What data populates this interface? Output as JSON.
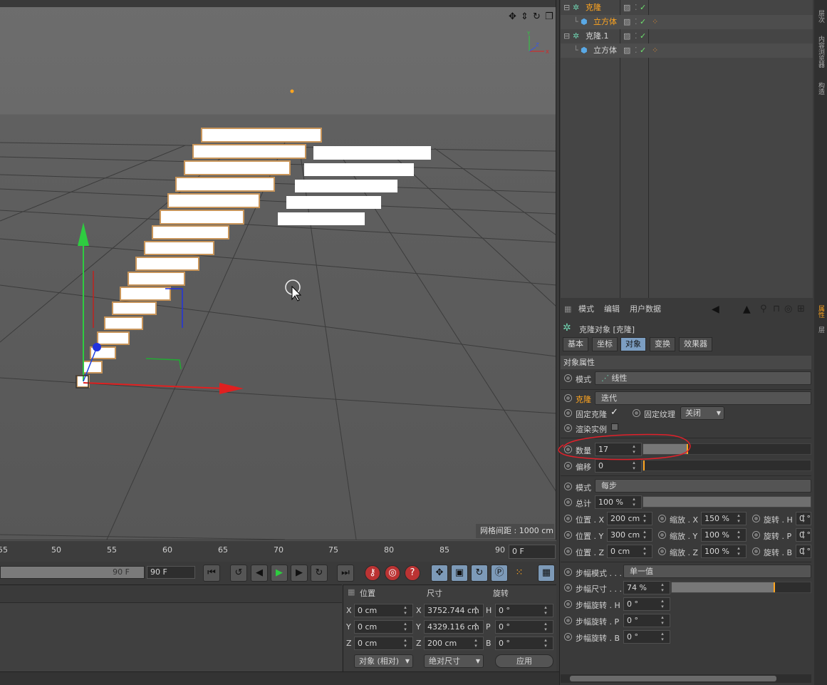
{
  "viewport": {
    "grid_readout": "网格间距 : 1000 cm"
  },
  "timeline": {
    "ticks": [
      "55",
      "50",
      "55",
      "60",
      "65",
      "70",
      "75",
      "80",
      "85",
      "90"
    ],
    "current_frame": "0 F",
    "range_end_label": "90 F",
    "end_frame": "90 F"
  },
  "coords": {
    "headers": {
      "position": "位置",
      "size": "尺寸",
      "rotation": "旋转"
    },
    "rows": [
      {
        "axis": "X",
        "pos": "0 cm",
        "size_axis": "X",
        "size": "3752.744 cm",
        "rot_axis": "H",
        "rot": "0 °"
      },
      {
        "axis": "Y",
        "pos": "0 cm",
        "size_axis": "Y",
        "size": "4329.116 cm",
        "rot_axis": "P",
        "rot": "0 °"
      },
      {
        "axis": "Z",
        "pos": "0 cm",
        "size_axis": "Z",
        "size": "200 cm",
        "rot_axis": "B",
        "rot": "0 °"
      }
    ],
    "mode_dropdown": "对象 (相对)",
    "size_dropdown": "绝对尺寸",
    "apply_button": "应用"
  },
  "object_manager": {
    "items": [
      {
        "name": "克隆",
        "indent": 0,
        "selected": true
      },
      {
        "name": "立方体",
        "indent": 1,
        "selected": true
      },
      {
        "name": "克隆.1",
        "indent": 0,
        "selected": false
      },
      {
        "name": "立方体",
        "indent": 1,
        "selected": false
      }
    ]
  },
  "attributes": {
    "menu": [
      "模式",
      "编辑",
      "用户数据"
    ],
    "title": "克隆对象 [克隆]",
    "tabs": [
      "基本",
      "坐标",
      "对象",
      "变换",
      "效果器"
    ],
    "active_tab": "对象",
    "section": "对象属性",
    "mode_label": "模式",
    "mode_value": "线性",
    "clone_label": "克隆",
    "clone_value": "迭代",
    "fix_clone_label": "固定克隆",
    "fix_clone_check": "✓",
    "fix_texture_label": "固定纹理",
    "fix_texture_value": "关闭",
    "render_instance_label": "渲染实例",
    "count_label": "数量",
    "count_value": "17",
    "count_fraction": 0.26,
    "offset_label": "偏移",
    "offset_value": "0",
    "mode2_label": "模式",
    "mode2_value": "每步",
    "total_label": "总计",
    "total_value": "100 %",
    "transform_rows": [
      {
        "pl": "位置 . X",
        "pv": "200 cm",
        "sl": "缩放 . X",
        "sv": "150 %",
        "rl": "旋转 . H",
        "rv": "0 °"
      },
      {
        "pl": "位置 . Y",
        "pv": "300 cm",
        "sl": "缩放 . Y",
        "sv": "100 %",
        "rl": "旋转 . P",
        "rv": "0 °"
      },
      {
        "pl": "位置 . Z",
        "pv": "0 cm",
        "sl": "缩放 . Z",
        "sv": "100 %",
        "rl": "旋转 . B",
        "rv": "0 °"
      }
    ],
    "step_mode_label": "步幅模式 . . .",
    "step_mode_value": "单一值",
    "step_size_label": "步幅尺寸 . . .",
    "step_size_value": "74 %",
    "step_size_fraction": 0.74,
    "step_rot_rows": [
      {
        "label": "步幅旋转 . H",
        "value": "0 °"
      },
      {
        "label": "步幅旋转 . P",
        "value": "0 °"
      },
      {
        "label": "步幅旋转 . B",
        "value": "0 °"
      }
    ]
  },
  "side_tabs": [
    "层次",
    "内容浏览器",
    "构造",
    "属性",
    "层"
  ],
  "colors": {
    "accent": "#ffa520",
    "active_tab": "#7c9ec2",
    "annotation": "#e0202a"
  }
}
